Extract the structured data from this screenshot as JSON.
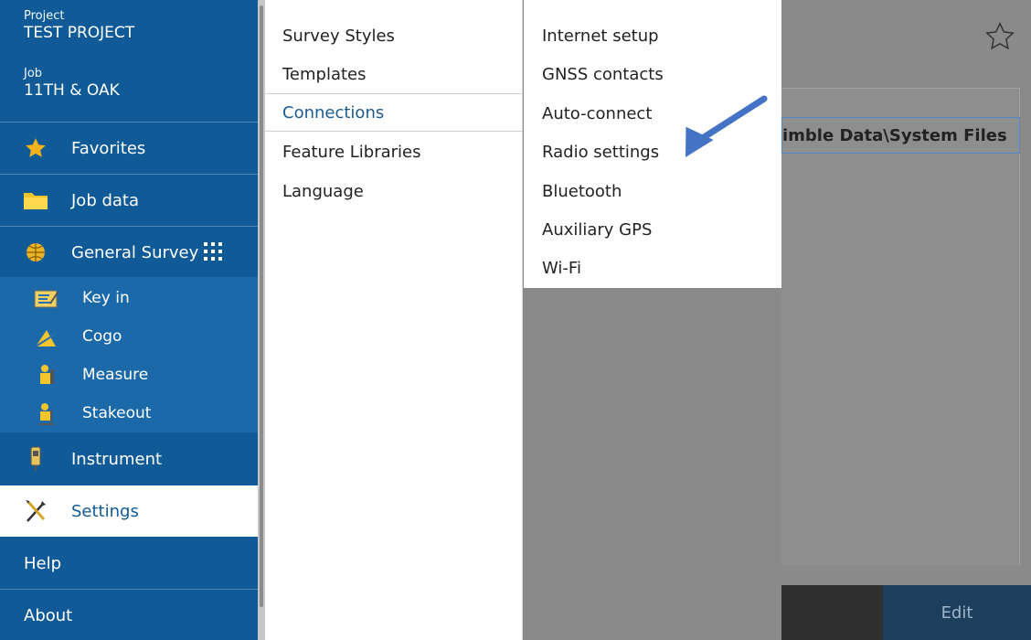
{
  "sidebar": {
    "project_label": "Project",
    "project_name": "TEST PROJECT",
    "job_label": "Job",
    "job_name": "11TH & OAK",
    "items": [
      {
        "label": "Favorites",
        "icon": "star-icon"
      },
      {
        "label": "Job data",
        "icon": "folder-icon"
      },
      {
        "label": "General Survey",
        "icon": "globe-icon"
      },
      {
        "label": "Instrument",
        "icon": "instrument-icon"
      },
      {
        "label": "Settings",
        "icon": "settings-tools-icon"
      },
      {
        "label": "Help"
      },
      {
        "label": "About"
      }
    ],
    "sub_items": [
      {
        "label": "Key in",
        "icon": "keyin-icon"
      },
      {
        "label": "Cogo",
        "icon": "cogo-icon"
      },
      {
        "label": "Measure",
        "icon": "measure-icon"
      },
      {
        "label": "Stakeout",
        "icon": "stakeout-icon"
      }
    ]
  },
  "settings_menu": {
    "items": [
      "Survey Styles",
      "Templates",
      "Connections",
      "Feature Libraries",
      "Language"
    ],
    "selected": "Connections"
  },
  "connections_menu": {
    "items": [
      "Internet setup",
      "GNSS contacts",
      "Auto-connect",
      "Radio settings",
      "Bluetooth",
      "Auxiliary GPS",
      "Wi-Fi"
    ]
  },
  "background": {
    "path_field": "imble Data\\System Files",
    "edit_label": "Edit"
  },
  "colors": {
    "sidebar": "#0f5a97",
    "sidebar_sub": "#1b69a8",
    "accent_arrow": "#4472c4",
    "selected_text": "#1a5a91"
  }
}
